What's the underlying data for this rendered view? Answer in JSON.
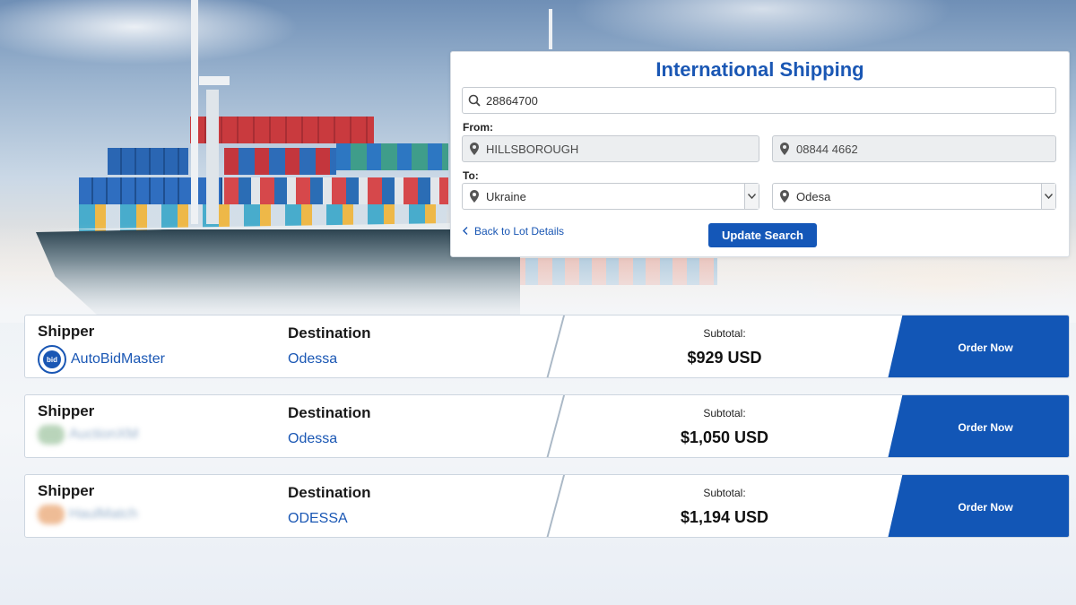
{
  "search_panel": {
    "title": "International Shipping",
    "lot_query": "28864700",
    "from_label": "From:",
    "from_city": "HILLSBOROUGH",
    "from_zip": "08844 4662",
    "to_label": "To:",
    "to_country": "Ukraine",
    "to_port": "Odesa",
    "back_link": "Back to Lot Details",
    "update_button": "Update Search"
  },
  "results": [
    {
      "shipper_header": "Shipper",
      "shipper_name": "AutoBidMaster",
      "shipper_logo_text": "bid",
      "destination_header": "Destination",
      "destination": "Odessa",
      "subtotal_label": "Subtotal:",
      "subtotal": "$929 USD",
      "order_button": "Order Now"
    },
    {
      "shipper_header": "Shipper",
      "shipper_name": "AuctionXM",
      "destination_header": "Destination",
      "destination": "Odessa",
      "subtotal_label": "Subtotal:",
      "subtotal": "$1,050 USD",
      "order_button": "Order Now"
    },
    {
      "shipper_header": "Shipper",
      "shipper_name": "HaulMatch",
      "destination_header": "Destination",
      "destination": "ODESSA",
      "subtotal_label": "Subtotal:",
      "subtotal": "$1,194 USD",
      "order_button": "Order Now"
    }
  ],
  "colors": {
    "brand_blue": "#1a57b4",
    "button_blue": "#1256b6"
  }
}
